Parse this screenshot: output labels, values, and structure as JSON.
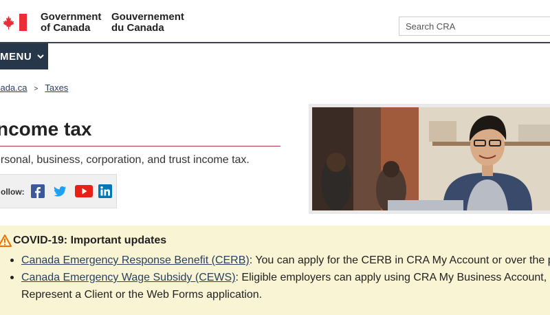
{
  "header": {
    "wordmark_en_line1": "Government",
    "wordmark_en_line2": "of Canada",
    "wordmark_fr_line1": "Gouvernement",
    "wordmark_fr_line2": "du Canada",
    "search_placeholder": "Search CRA"
  },
  "menu": {
    "label": "MENU"
  },
  "breadcrumb": [
    {
      "label": "anada.ca"
    },
    {
      "label": "Taxes"
    }
  ],
  "page": {
    "title": "ncome tax",
    "subtitle": "ersonal, business, corporation, and trust income tax."
  },
  "follow": {
    "label": "ollow:",
    "icons": [
      "facebook-icon",
      "twitter-icon",
      "youtube-icon",
      "linkedin-icon"
    ]
  },
  "alert": {
    "heading": "COVID-19: Important updates",
    "items": [
      {
        "link": "Canada Emergency Response Benefit (CERB)",
        "text": ": You can apply for the CERB in CRA My Account or over the pho",
        "cont": ""
      },
      {
        "link": "Canada Emergency Wage Subsidy (CEWS)",
        "text": ": Eligible employers can apply using CRA My Business Account,",
        "cont": "Represent a Client or the Web Forms application."
      }
    ]
  },
  "colors": {
    "menu_bg": "#26374a",
    "alert_bg": "#f9f4d4",
    "link": "#284162",
    "title_rule": "#af3c43"
  }
}
